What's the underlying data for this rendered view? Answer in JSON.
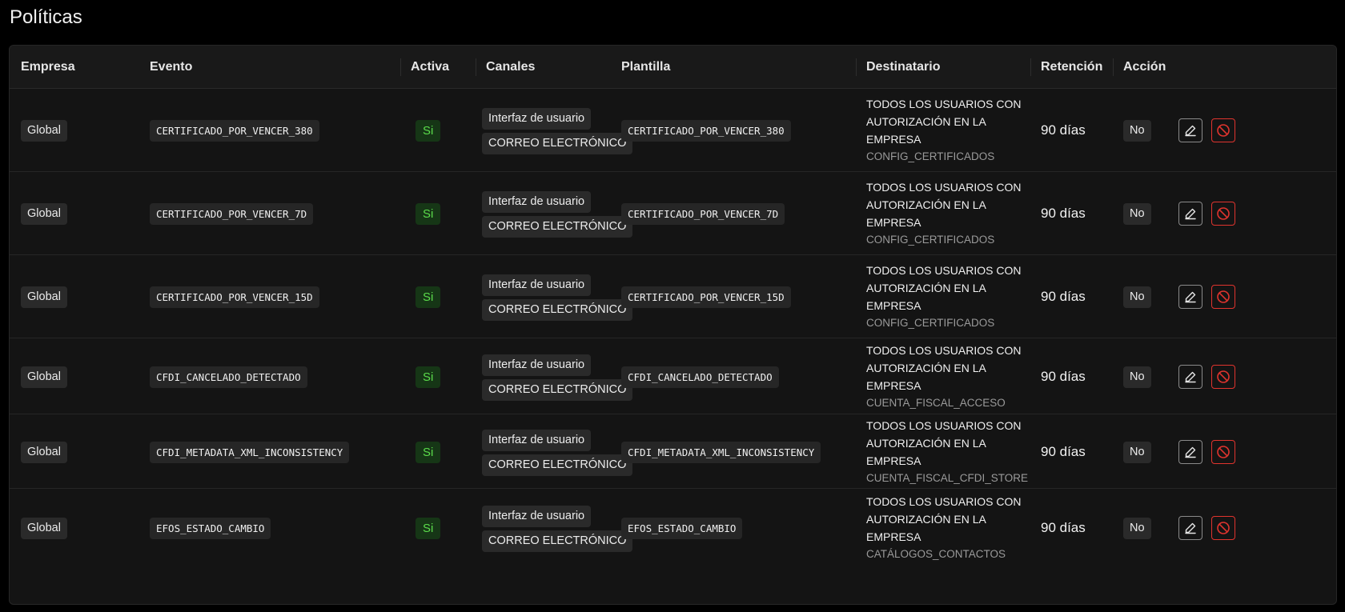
{
  "page": {
    "title": "Políticas"
  },
  "table": {
    "columns": {
      "empresa": "Empresa",
      "evento": "Evento",
      "activa": "Activa",
      "canales": "Canales",
      "plantilla": "Plantilla",
      "destinatario": "Destinatario",
      "retencion": "Retención",
      "accion": "Acción"
    },
    "rows": [
      {
        "empresa": "Global",
        "evento": "CERTIFICADO_POR_VENCER_380",
        "activa": "Si",
        "canal_1": "Interfaz de usuario",
        "canal_2": "CORREO ELECTRÓNICO",
        "plantilla": "CERTIFICADO_POR_VENCER_380",
        "destinatario": "TODOS LOS USUARIOS CON AUTORIZACIÓN EN LA EMPRESA",
        "permiso": "CONFIG_CERTIFICADOS",
        "retencion": "90 días",
        "accion": "No"
      },
      {
        "empresa": "Global",
        "evento": "CERTIFICADO_POR_VENCER_7D",
        "activa": "Si",
        "canal_1": "Interfaz de usuario",
        "canal_2": "CORREO ELECTRÓNICO",
        "plantilla": "CERTIFICADO_POR_VENCER_7D",
        "destinatario": "TODOS LOS USUARIOS CON AUTORIZACIÓN EN LA EMPRESA",
        "permiso": "CONFIG_CERTIFICADOS",
        "retencion": "90 días",
        "accion": "No"
      },
      {
        "empresa": "Global",
        "evento": "CERTIFICADO_POR_VENCER_15D",
        "activa": "Si",
        "canal_1": "Interfaz de usuario",
        "canal_2": "CORREO ELECTRÓNICO",
        "plantilla": "CERTIFICADO_POR_VENCER_15D",
        "destinatario": "TODOS LOS USUARIOS CON AUTORIZACIÓN EN LA EMPRESA",
        "permiso": "CONFIG_CERTIFICADOS",
        "retencion": "90 días",
        "accion": "No"
      },
      {
        "empresa": "Global",
        "evento": "CFDI_CANCELADO_DETECTADO",
        "activa": "Si",
        "canal_1": "Interfaz de usuario",
        "canal_2": "CORREO ELECTRÓNICO",
        "plantilla": "CFDI_CANCELADO_DETECTADO",
        "destinatario": "TODOS LOS USUARIOS CON AUTORIZACIÓN EN LA EMPRESA",
        "permiso": "CUENTA_FISCAL_ACCESO",
        "retencion": "90 días",
        "accion": "No"
      },
      {
        "empresa": "Global",
        "evento": "CFDI_METADATA_XML_INCONSISTENCY",
        "activa": "Si",
        "canal_1": "Interfaz de usuario",
        "canal_2": "CORREO ELECTRÓNICO",
        "plantilla": "CFDI_METADATA_XML_INCONSISTENCY",
        "destinatario": "TODOS LOS USUARIOS CON AUTORIZACIÓN EN LA EMPRESA",
        "permiso": "CUENTA_FISCAL_CFDI_STORE",
        "retencion": "90 días",
        "accion": "No"
      },
      {
        "empresa": "Global",
        "evento": "EFOS_ESTADO_CAMBIO",
        "activa": "Si",
        "canal_1": "Interfaz de usuario",
        "canal_2": "CORREO ELECTRÓNICO",
        "plantilla": "EFOS_ESTADO_CAMBIO",
        "destinatario": "TODOS LOS USUARIOS CON AUTORIZACIÓN EN LA EMPRESA",
        "permiso": "CATÁLOGOS_CONTACTOS",
        "retencion": "90 días",
        "accion": "No"
      }
    ]
  },
  "icons": {
    "edit": "pencil-edit-icon",
    "disable": "block-icon"
  },
  "colors": {
    "active_text": "#5bdc4b",
    "active_bg": "#163616",
    "danger": "#e0342e"
  }
}
